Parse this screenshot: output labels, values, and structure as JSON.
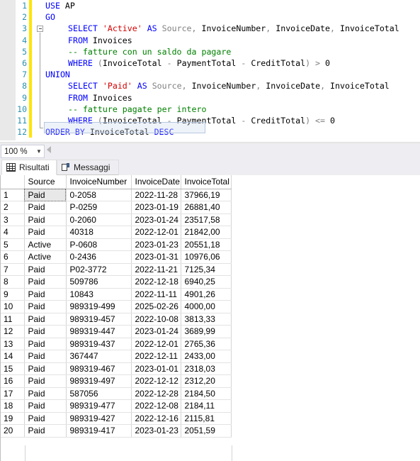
{
  "editor": {
    "zoom_level": "100 %",
    "lines": [
      {
        "num": "1",
        "indent": false,
        "tokens": [
          {
            "t": "USE ",
            "c": "kw"
          },
          {
            "t": "AP",
            "c": "plain"
          }
        ]
      },
      {
        "num": "2",
        "indent": false,
        "tokens": [
          {
            "t": "GO",
            "c": "kw"
          }
        ]
      },
      {
        "num": "3",
        "indent": true,
        "tokens": [
          {
            "t": "SELECT ",
            "c": "kw"
          },
          {
            "t": "'Active'",
            "c": "str"
          },
          {
            "t": " ",
            "c": "plain"
          },
          {
            "t": "AS",
            "c": "kw"
          },
          {
            "t": " ",
            "c": "plain"
          },
          {
            "t": "Source",
            "c": "gray"
          },
          {
            "t": ", ",
            "c": "op"
          },
          {
            "t": "InvoiceNumber",
            "c": "plain"
          },
          {
            "t": ", ",
            "c": "op"
          },
          {
            "t": "InvoiceDate",
            "c": "plain"
          },
          {
            "t": ", ",
            "c": "op"
          },
          {
            "t": "InvoiceTotal",
            "c": "plain"
          }
        ]
      },
      {
        "num": "4",
        "indent": true,
        "tokens": [
          {
            "t": "FROM ",
            "c": "kw"
          },
          {
            "t": "Invoices",
            "c": "plain"
          }
        ]
      },
      {
        "num": "5",
        "indent": true,
        "tokens": [
          {
            "t": "-- fatture con un saldo da pagare",
            "c": "cmt"
          }
        ]
      },
      {
        "num": "6",
        "indent": true,
        "tokens": [
          {
            "t": "WHERE ",
            "c": "kw"
          },
          {
            "t": "(",
            "c": "op"
          },
          {
            "t": "InvoiceTotal",
            "c": "plain"
          },
          {
            "t": " - ",
            "c": "op"
          },
          {
            "t": "PaymentTotal",
            "c": "plain"
          },
          {
            "t": " - ",
            "c": "op"
          },
          {
            "t": "CreditTotal",
            "c": "plain"
          },
          {
            "t": ")",
            "c": "op"
          },
          {
            "t": " > ",
            "c": "op"
          },
          {
            "t": "0",
            "c": "plain"
          }
        ]
      },
      {
        "num": "7",
        "indent": false,
        "tokens": [
          {
            "t": "UNION",
            "c": "kw"
          }
        ]
      },
      {
        "num": "8",
        "indent": true,
        "tokens": [
          {
            "t": "SELECT ",
            "c": "kw"
          },
          {
            "t": "'Paid'",
            "c": "str"
          },
          {
            "t": " ",
            "c": "plain"
          },
          {
            "t": "AS",
            "c": "kw"
          },
          {
            "t": " ",
            "c": "plain"
          },
          {
            "t": "Source",
            "c": "gray"
          },
          {
            "t": ", ",
            "c": "op"
          },
          {
            "t": "InvoiceNumber",
            "c": "plain"
          },
          {
            "t": ", ",
            "c": "op"
          },
          {
            "t": "InvoiceDate",
            "c": "plain"
          },
          {
            "t": ", ",
            "c": "op"
          },
          {
            "t": "InvoiceTotal",
            "c": "plain"
          }
        ]
      },
      {
        "num": "9",
        "indent": true,
        "tokens": [
          {
            "t": "FROM ",
            "c": "kw"
          },
          {
            "t": "Invoices",
            "c": "plain"
          }
        ]
      },
      {
        "num": "10",
        "indent": true,
        "tokens": [
          {
            "t": "-- fatture pagate per intero",
            "c": "cmt"
          }
        ]
      },
      {
        "num": "11",
        "indent": true,
        "tokens": [
          {
            "t": "WHERE ",
            "c": "kw"
          },
          {
            "t": "(",
            "c": "op"
          },
          {
            "t": "InvoiceTotal",
            "c": "plain"
          },
          {
            "t": " - ",
            "c": "op"
          },
          {
            "t": "PaymentTotal",
            "c": "plain"
          },
          {
            "t": " - ",
            "c": "op"
          },
          {
            "t": "CreditTotal",
            "c": "plain"
          },
          {
            "t": ")",
            "c": "op"
          },
          {
            "t": " <= ",
            "c": "op"
          },
          {
            "t": "0",
            "c": "plain"
          }
        ]
      },
      {
        "num": "12",
        "indent": false,
        "tokens": [
          {
            "t": "ORDER BY ",
            "c": "kw"
          },
          {
            "t": "InvoiceTotal",
            "c": "plain"
          },
          {
            "t": " ",
            "c": "plain"
          },
          {
            "t": "DESC",
            "c": "kw"
          }
        ]
      }
    ]
  },
  "results": {
    "tabs": [
      {
        "label": "Risultati",
        "icon": "grid-icon",
        "active": true
      },
      {
        "label": "Messaggi",
        "icon": "message-icon",
        "active": false
      }
    ],
    "columns": [
      "",
      "Source",
      "InvoiceNumber",
      "InvoiceDate",
      "InvoiceTotal"
    ],
    "rows": [
      {
        "n": "1",
        "source": "Paid",
        "number": "0-2058",
        "date": "2022-11-28",
        "total": "37966,19"
      },
      {
        "n": "2",
        "source": "Paid",
        "number": "P-0259",
        "date": "2023-01-19",
        "total": "26881,40"
      },
      {
        "n": "3",
        "source": "Paid",
        "number": "0-2060",
        "date": "2023-01-24",
        "total": "23517,58"
      },
      {
        "n": "4",
        "source": "Paid",
        "number": "40318",
        "date": "2022-12-01",
        "total": "21842,00"
      },
      {
        "n": "5",
        "source": "Active",
        "number": "P-0608",
        "date": "2023-01-23",
        "total": "20551,18"
      },
      {
        "n": "6",
        "source": "Active",
        "number": "0-2436",
        "date": "2023-01-31",
        "total": "10976,06"
      },
      {
        "n": "7",
        "source": "Paid",
        "number": "P02-3772",
        "date": "2022-11-21",
        "total": "7125,34"
      },
      {
        "n": "8",
        "source": "Paid",
        "number": "509786",
        "date": "2022-12-18",
        "total": "6940,25"
      },
      {
        "n": "9",
        "source": "Paid",
        "number": "10843",
        "date": "2022-11-11",
        "total": "4901,26"
      },
      {
        "n": "10",
        "source": "Paid",
        "number": "989319-499",
        "date": "2025-02-26",
        "total": "4000,00"
      },
      {
        "n": "11",
        "source": "Paid",
        "number": "989319-457",
        "date": "2022-10-08",
        "total": "3813,33"
      },
      {
        "n": "12",
        "source": "Paid",
        "number": "989319-447",
        "date": "2023-01-24",
        "total": "3689,99"
      },
      {
        "n": "13",
        "source": "Paid",
        "number": "989319-437",
        "date": "2022-12-01",
        "total": "2765,36"
      },
      {
        "n": "14",
        "source": "Paid",
        "number": "367447",
        "date": "2022-12-11",
        "total": "2433,00"
      },
      {
        "n": "15",
        "source": "Paid",
        "number": "989319-467",
        "date": "2023-01-01",
        "total": "2318,03"
      },
      {
        "n": "16",
        "source": "Paid",
        "number": "989319-497",
        "date": "2022-12-12",
        "total": "2312,20"
      },
      {
        "n": "17",
        "source": "Paid",
        "number": "587056",
        "date": "2022-12-28",
        "total": "2184,50"
      },
      {
        "n": "18",
        "source": "Paid",
        "number": "989319-477",
        "date": "2022-12-08",
        "total": "2184,11"
      },
      {
        "n": "19",
        "source": "Paid",
        "number": "989319-427",
        "date": "2022-12-16",
        "total": "2115,81"
      },
      {
        "n": "20",
        "source": "Paid",
        "number": "989319-417",
        "date": "2023-01-23",
        "total": "2051,59"
      }
    ],
    "focused_cell": {
      "row": 0,
      "column": "source"
    }
  },
  "colors": {
    "keyword": "#0000ff",
    "string": "#d40000",
    "comment": "#008000",
    "line_number": "#2b91af",
    "change_bar": "#ffe400",
    "chrome": "#eeeef2"
  }
}
